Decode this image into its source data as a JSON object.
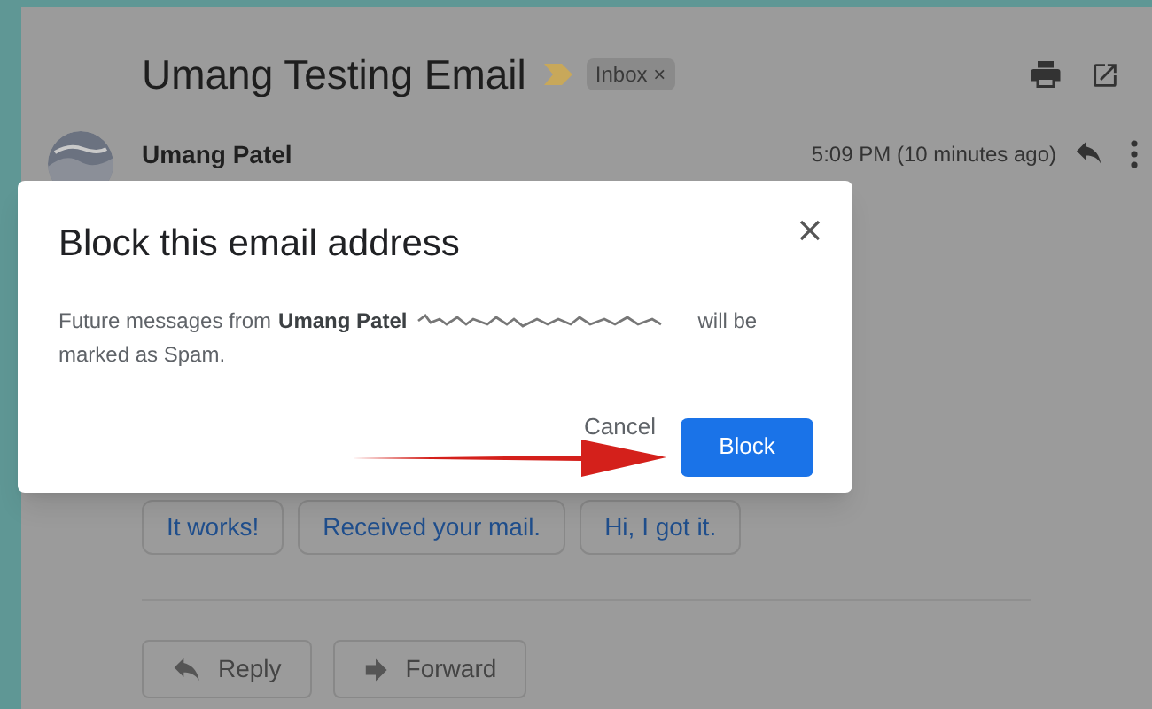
{
  "email": {
    "subject": "Umang Testing Email",
    "label": {
      "text": "Inbox",
      "remove": "×"
    },
    "sender": "Umang Patel",
    "time": "5:09 PM (10 minutes ago)"
  },
  "smart_replies": [
    "It works!",
    "Received your mail.",
    "Hi, I got it."
  ],
  "actions": [
    {
      "kind": "reply",
      "label": "Reply"
    },
    {
      "kind": "forward",
      "label": "Forward"
    }
  ],
  "dialog": {
    "title": "Block this email address",
    "message_start": "Future messages from",
    "sender": "Umang Patel",
    "message_end": "will be",
    "message_line2": "marked as Spam.",
    "buttons": [
      {
        "kind": "text",
        "label": "Cancel"
      },
      {
        "kind": "primary",
        "label": "Block"
      }
    ]
  }
}
